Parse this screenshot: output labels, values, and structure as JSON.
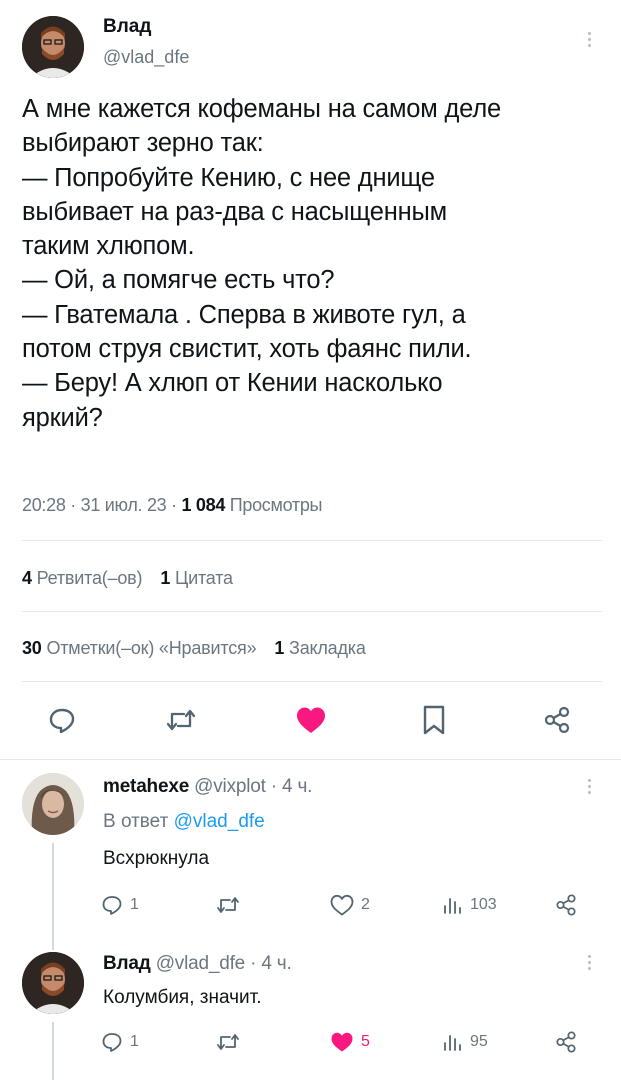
{
  "main_tweet": {
    "author_name": "Влад",
    "author_handle": "@vlad_dfe",
    "text_lines": [
      "А мне кажется кофеманы на самом деле",
      "выбирают зерно так:",
      "— Попробуйте Кению, с нее днище",
      "выбивает на раз-два с насыщенным",
      "таким хлюпом.",
      "— Ой, а помягче есть что?",
      "— Гватемала . Сперва в животе гул, а",
      "потом струя свистит, хоть фаянс пили.",
      "— Беру! А хлюп от Кении насколько",
      "яркий?"
    ],
    "time": "20:28",
    "date": "31 июл. 23",
    "views_count": "1 084",
    "views_label": "Просмотры",
    "retweets_count": "4",
    "retweets_label": "Ретвита(–ов)",
    "quotes_count": "1",
    "quotes_label": "Цитата",
    "likes_count": "30",
    "likes_label": "Отметки(–ок) «Нравится»",
    "bookmarks_count": "1",
    "bookmarks_label": "Закладка",
    "actions": [
      "reply-icon",
      "retweet-icon",
      "heart-filled-icon",
      "bookmark-icon",
      "share-icon"
    ],
    "like_color": "#f91880"
  },
  "replies": [
    {
      "author_name": "metahexe",
      "author_handle": "@vixplot",
      "time_ago": "· 4 ч.",
      "reply_to_prefix": "В ответ",
      "reply_to_handle": "@vlad_dfe",
      "text": "Всхрюкнула",
      "reply_count": "1",
      "retweet_count": "",
      "like_count": "2",
      "liked": false,
      "views_count": "103"
    },
    {
      "author_name": "Влад",
      "author_handle": "@vlad_dfe",
      "time_ago": "· 4 ч.",
      "text": "Колумбия, значит.",
      "reply_count": "1",
      "retweet_count": "",
      "like_count": "5",
      "liked": true,
      "views_count": "95"
    }
  ],
  "colors": {
    "accent": "#1d9bf0",
    "like": "#f91880",
    "muted_text": "#6b7680",
    "divider": "#e6e9eb"
  }
}
